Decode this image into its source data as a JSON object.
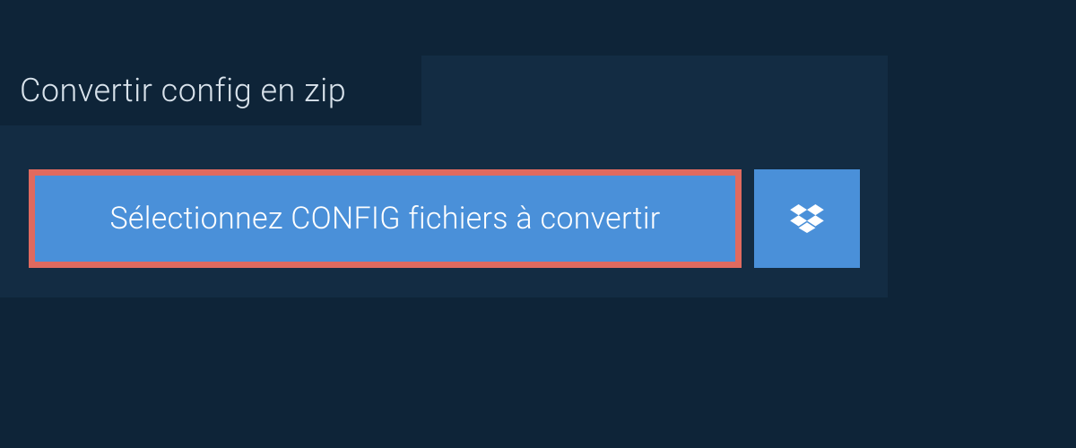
{
  "tab": {
    "label": "Convertir config en zip"
  },
  "actions": {
    "select_files_label": "Sélectionnez CONFIG fichiers à convertir"
  },
  "colors": {
    "page_bg": "#0e2438",
    "panel_bg": "#132c43",
    "button_bg": "#4a90d9",
    "highlight_border": "#e06a5f",
    "text_light": "#d9e3ec",
    "text_white": "#ffffff"
  }
}
